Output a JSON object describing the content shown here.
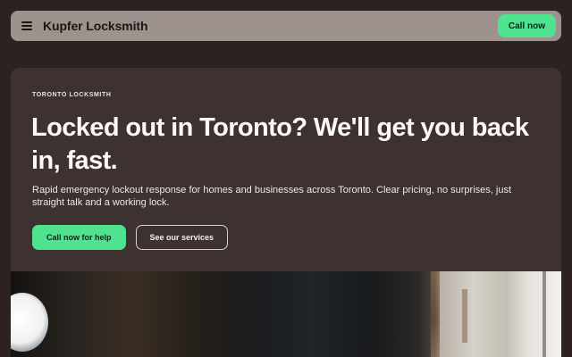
{
  "header": {
    "brand": "Kupfer Locksmith",
    "call_label": "Call now",
    "menu_icon": "hamburger-menu-icon"
  },
  "hero": {
    "eyebrow": "TORONTO LOCKSMITH",
    "headline": "Locked out in Toronto? We'll get you back in, fast.",
    "subtext": "Rapid emergency lockout response for homes and businesses across Toronto. Clear pricing, no surprises, just straight talk and a working lock.",
    "primary_cta": "Call now for help",
    "secondary_cta": "See our services"
  },
  "colors": {
    "accent": "#4fe38f",
    "background": "#2c2220",
    "card": "#3d322f",
    "navbar": "#9d928e"
  }
}
